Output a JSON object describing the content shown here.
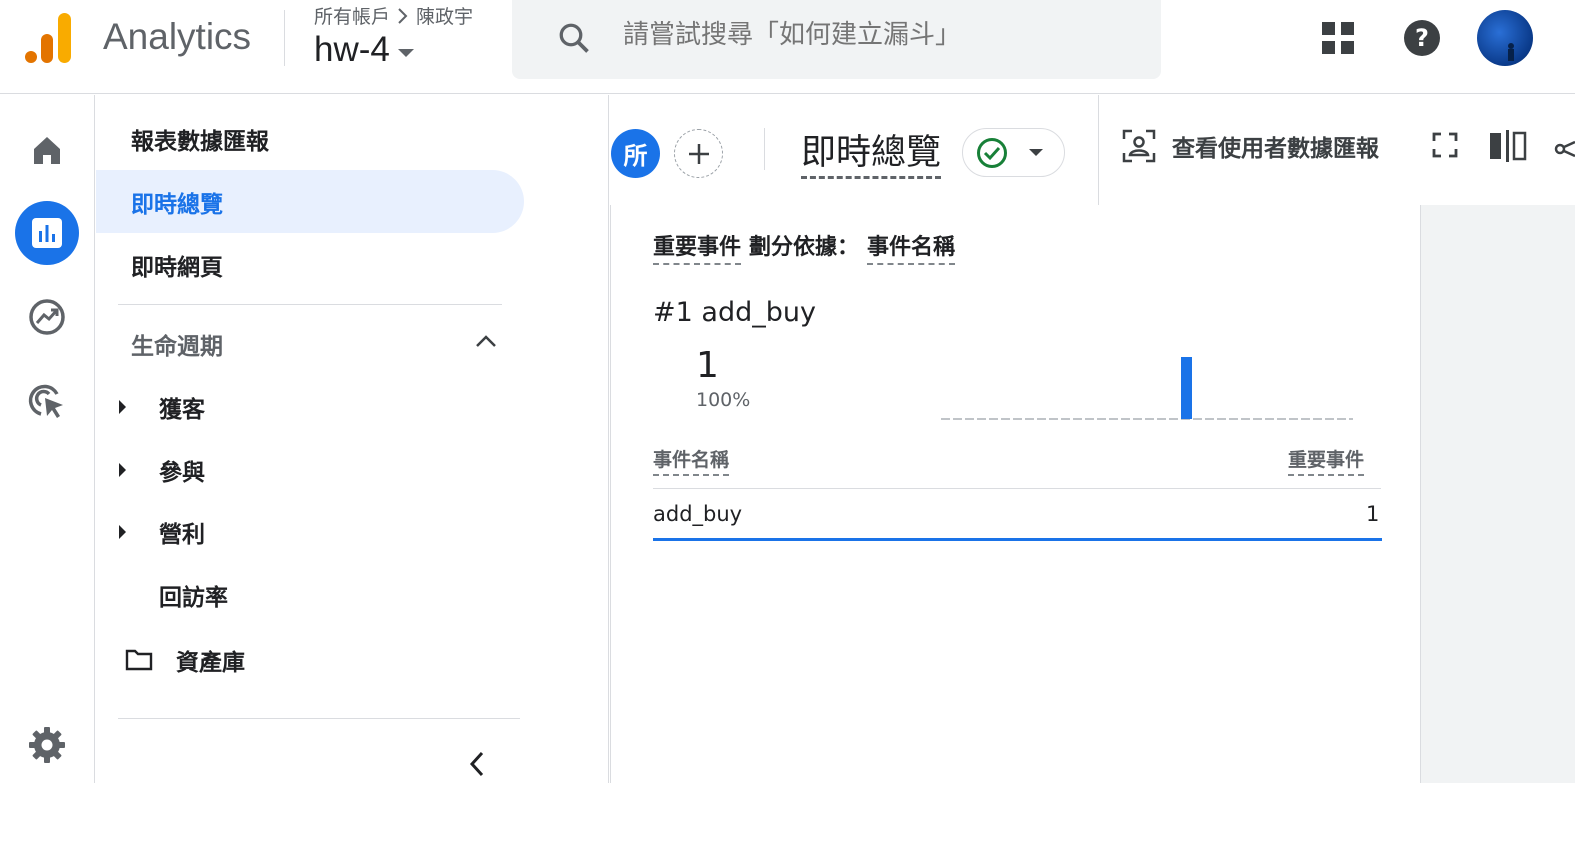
{
  "header": {
    "app_title": "Analytics",
    "breadcrumb": {
      "root": "所有帳戶",
      "account": "陳政宇"
    },
    "property": "hw-4",
    "search_placeholder": "請嘗試搜尋「如何建立漏斗」",
    "icons": [
      "apps-icon",
      "help-icon",
      "avatar"
    ]
  },
  "rail": {
    "items": [
      "home-icon",
      "reports-icon",
      "explore-icon",
      "advertising-icon",
      "settings-icon"
    ],
    "active": "reports-icon"
  },
  "sidebar": {
    "top_items": [
      {
        "label": "報表數據匯報"
      },
      {
        "label": "即時總覽",
        "active": true
      },
      {
        "label": "即時網頁"
      }
    ],
    "section": {
      "title": "生命週期"
    },
    "sub_items": [
      {
        "label": "獲客",
        "expandable": true
      },
      {
        "label": "參與",
        "expandable": true
      },
      {
        "label": "營利",
        "expandable": true
      },
      {
        "label": "回訪率",
        "expandable": false
      }
    ],
    "library": {
      "label": "資產庫"
    }
  },
  "toolbar": {
    "comparison_chip": "所",
    "report_title": "即時總覽",
    "user_report_label": "查看使用者數據匯報",
    "accent": "#1a73e8",
    "status_color": "#188038"
  },
  "card": {
    "header": {
      "metric": "重要事件",
      "by": "劃分依據：",
      "dimension": "事件名稱"
    },
    "top": {
      "rank": "#1",
      "name": "add_buy",
      "value": "1",
      "percent": "100%"
    },
    "table": {
      "columns": [
        "事件名稱",
        "重要事件"
      ],
      "rows": [
        {
          "name": "add_buy",
          "value": "1"
        }
      ]
    }
  },
  "chart_data": {
    "type": "bar",
    "title": "",
    "series": [
      {
        "values": [
          0,
          0,
          0,
          0,
          0,
          0,
          0,
          0,
          0,
          0,
          0,
          0,
          0,
          0,
          0,
          0,
          0,
          0,
          0,
          0,
          0,
          0,
          0,
          0,
          0,
          0,
          0,
          0,
          0,
          0,
          0,
          0,
          0,
          0,
          0,
          0,
          0,
          0,
          0,
          0,
          0,
          0,
          0,
          0,
          0,
          0,
          0,
          0,
          0,
          0,
          0,
          0,
          0,
          0,
          0,
          0,
          0,
          0,
          0,
          0,
          1,
          0,
          0,
          0,
          0,
          0,
          0,
          0,
          0,
          0,
          0,
          0,
          0,
          0,
          0,
          0,
          0,
          0,
          0,
          0,
          0,
          0,
          0,
          0,
          0,
          0,
          0,
          0,
          0,
          0,
          0,
          0,
          0,
          0,
          0,
          0,
          0,
          0,
          0,
          0,
          0,
          0,
          0
        ]
      }
    ],
    "ylim": [
      0,
      1
    ],
    "color": "#1a73e8",
    "baseline_color": "#9aa0a6"
  }
}
